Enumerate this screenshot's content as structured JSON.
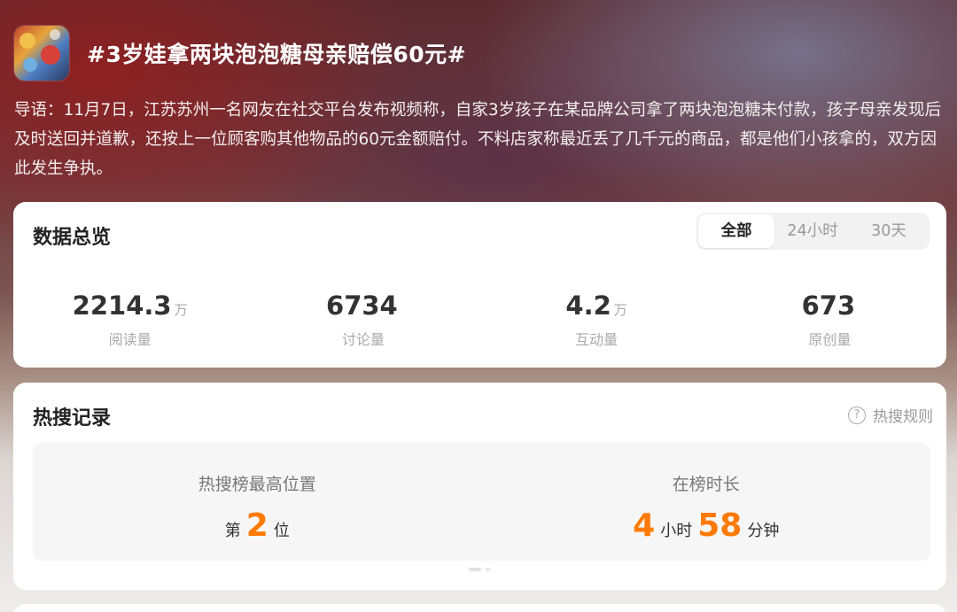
{
  "topic": {
    "title": "#3岁娃拿两块泡泡糖母亲赔偿60元#",
    "intro": "导语：11月7日，江苏苏州一名网友在社交平台发布视频称，自家3岁孩子在某品牌公司拿了两块泡泡糖未付款，孩子母亲发现后及时送回并道歉，还按上一位顾客购其他物品的60元金额赔付。不料店家称最近丢了几千元的商品，都是他们小孩拿的，双方因此发生争执。"
  },
  "overview": {
    "title": "数据总览",
    "tabs": [
      "全部",
      "24小时",
      "30天"
    ],
    "active_tab": "全部",
    "stats": [
      {
        "value": "2214.3",
        "unit": "万",
        "label": "阅读量"
      },
      {
        "value": "6734",
        "unit": "",
        "label": "讨论量"
      },
      {
        "value": "4.2",
        "unit": "万",
        "label": "互动量"
      },
      {
        "value": "673",
        "unit": "",
        "label": "原创量"
      }
    ]
  },
  "hot_search": {
    "title": "热搜记录",
    "rules_label": "热搜规则",
    "rules_icon": "question-circle-icon",
    "highest": {
      "label": "热搜榜最高位置",
      "prefix": "第",
      "value": "2",
      "suffix": "位"
    },
    "duration": {
      "label": "在榜时长",
      "hours": "4",
      "hours_unit": "小时",
      "minutes": "58",
      "minutes_unit": "分钟"
    }
  },
  "colors": {
    "accent": "#ff7a00",
    "card": "#ffffff"
  }
}
